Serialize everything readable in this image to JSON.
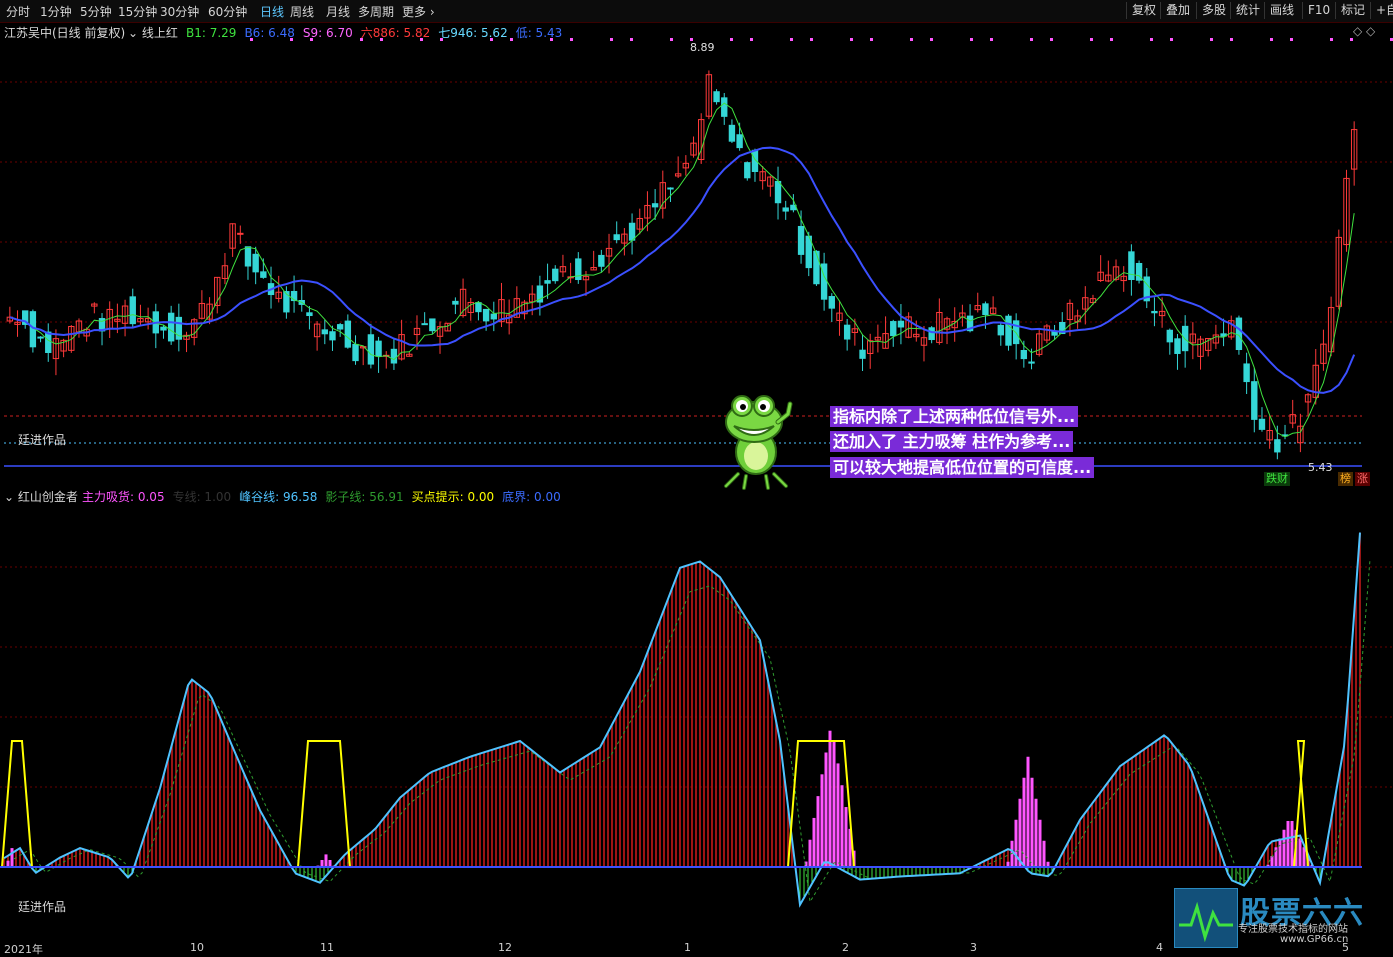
{
  "toolbar": {
    "periods": [
      "分时",
      "1分钟",
      "5分钟",
      "15分钟",
      "30分钟",
      "60分钟",
      "日线",
      "周线",
      "月线",
      "多周期",
      "更多 ›"
    ],
    "active_period": "日线",
    "right_buttons": [
      "复权",
      "叠加",
      "多股",
      "统计",
      "画线",
      "F10",
      "标记",
      "+自"
    ]
  },
  "main_panel": {
    "stock": "江苏吴中(日线 前复权)",
    "indicator": "线上红",
    "values": [
      {
        "label": "B1: 7.29",
        "color": "#3fe23f"
      },
      {
        "label": "B6: 6.48",
        "color": "#3b6cff"
      },
      {
        "label": "S9: 6.70",
        "color": "#ff66ff"
      },
      {
        "label": "六886: 5.82",
        "color": "#ff3a3a"
      },
      {
        "label": "七946: 5.62",
        "color": "#66d9ff"
      },
      {
        "label": "低: 5.43",
        "color": "#3b6cff"
      }
    ],
    "high_label": "8.89",
    "low_label": "5.43",
    "watermark": "廷进作品",
    "badges": {
      "drop": "跌财",
      "rank": "榜",
      "rise": "涨"
    }
  },
  "callout": {
    "lines": [
      "指标内除了上述两种低位信号外...",
      "还加入了 主力吸筹 柱作为参考...",
      "可以较大地提高低位位置的可信度..."
    ]
  },
  "indicator_panel": {
    "name": "红山创金者",
    "values": [
      {
        "label": "主力吸货: 0.05",
        "color": "#ff55ff"
      },
      {
        "label": "专线: 1.00",
        "color": "#333333"
      },
      {
        "label": "峰谷线: 96.58",
        "color": "#4fc3ff"
      },
      {
        "label": "影子线: 56.91",
        "color": "#2e9a2e"
      },
      {
        "label": "买点提示: 0.00",
        "color": "#ffff00"
      },
      {
        "label": "底界: 0.00",
        "color": "#3b6cff"
      }
    ],
    "watermark": "廷进作品"
  },
  "x_axis": [
    "2021年",
    "10",
    "11",
    "12",
    "1",
    "2",
    "3",
    "4",
    "5"
  ],
  "logo": {
    "name": "股票六六",
    "slogan": "专注股票技术指标的网站",
    "url": "www.GP66.cn"
  },
  "colors": {
    "up": "#ff3a3a",
    "down": "#35d6d6",
    "ma_blue": "#3b50ff",
    "ma_green": "#3fe23f",
    "peak": "#4fc3ff",
    "buy": "#ffff00",
    "absorb": "#ff55ff"
  },
  "chart_data": [
    {
      "type": "candlestick",
      "title": "江苏吴中(日线 前复权)",
      "ylim": [
        5.2,
        9.0
      ],
      "high": 8.89,
      "low": 5.43,
      "ma_series": [
        {
          "name": "B1",
          "value": 7.29
        },
        {
          "name": "B6",
          "value": 6.48
        }
      ],
      "closes": [
        6.5,
        6.6,
        6.4,
        6.3,
        6.35,
        6.5,
        6.55,
        6.5,
        6.6,
        6.55,
        6.5,
        6.45,
        6.4,
        6.6,
        6.9,
        7.3,
        7.0,
        6.9,
        6.7,
        6.6,
        6.5,
        6.45,
        6.4,
        6.3,
        6.25,
        6.2,
        6.3,
        6.4,
        6.5,
        6.6,
        6.7,
        6.65,
        6.6,
        6.65,
        6.7,
        6.8,
        6.9,
        6.95,
        7.0,
        7.1,
        7.2,
        7.3,
        7.4,
        7.6,
        7.7,
        8.0,
        8.5,
        8.2,
        7.9,
        7.8,
        7.7,
        7.5,
        7.2,
        6.9,
        6.6,
        6.4,
        6.3,
        6.4,
        6.5,
        6.45,
        6.4,
        6.5,
        6.55,
        6.5,
        6.6,
        6.5,
        6.3,
        6.2,
        6.4,
        6.5,
        6.6,
        6.8,
        6.9,
        7.0,
        6.8,
        6.6,
        6.4,
        6.3,
        6.35,
        6.4,
        6.5,
        6.0,
        5.6,
        5.5,
        5.6,
        5.8,
        6.3,
        7.2,
        8.2
      ]
    },
    {
      "type": "area",
      "title": "红山创金者",
      "ylim": [
        -20,
        120
      ],
      "series": [
        {
          "name": "峰谷线",
          "value": 96.58
        },
        {
          "name": "影子线",
          "value": 56.91
        },
        {
          "name": "主力吸货",
          "value": 0.05
        },
        {
          "name": "买点提示",
          "value": 0.0
        },
        {
          "name": "底界",
          "value": 0.0
        }
      ]
    }
  ]
}
